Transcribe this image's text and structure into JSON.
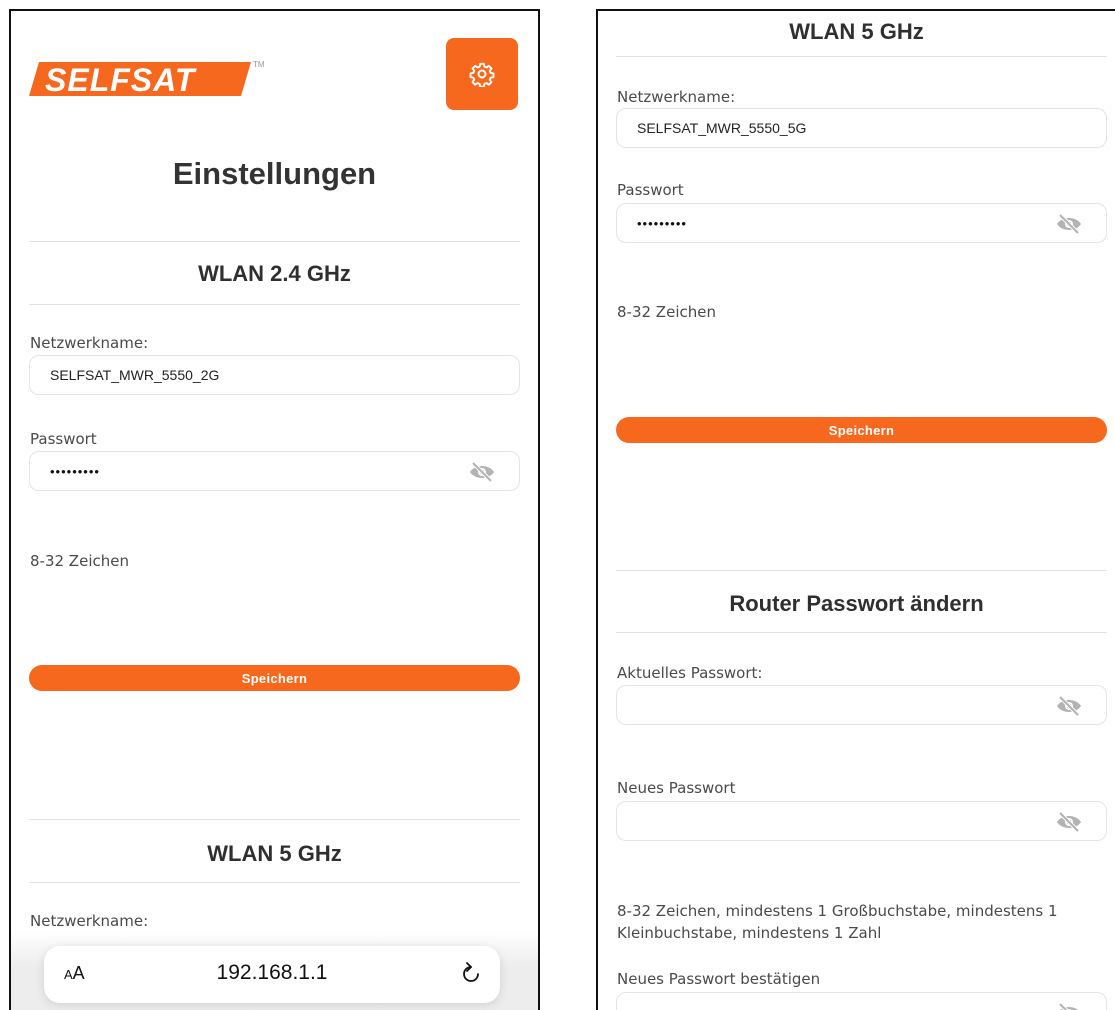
{
  "brand": {
    "logo_text": "SELFSAT",
    "trademark": "TM",
    "accent": "#f7681f"
  },
  "header": {
    "title": "Einstellungen",
    "settings_icon": "gear-icon"
  },
  "wlan24": {
    "heading": "WLAN 2.4 GHz",
    "ssid_label": "Netzwerkname:",
    "ssid_value": "SELFSAT_MWR_5550_2G",
    "password_label": "Passwort",
    "password_value": "•••••••••",
    "hint": "8-32 Zeichen",
    "save_label": "Speichern"
  },
  "wlan5": {
    "heading": "WLAN 5 GHz",
    "ssid_label": "Netzwerkname:",
    "ssid_value": "SELFSAT_MWR_5550_5G",
    "password_label": "Passwort",
    "password_value": "•••••••••",
    "hint": "8-32 Zeichen",
    "save_label": "Speichern"
  },
  "router_password": {
    "heading": "Router Passwort ändern",
    "current_label": "Aktuelles Passwort:",
    "new_label": "Neues Passwort",
    "rules_hint": "8-32 Zeichen, mindestens 1 Großbuchstabe, mindestens 1 Kleinbuchstabe, mindestens 1 Zahl",
    "confirm_label": "Neues Passwort bestätigen"
  },
  "browser": {
    "aa_small": "A",
    "aa_large": "A",
    "url": "192.168.1.1"
  }
}
